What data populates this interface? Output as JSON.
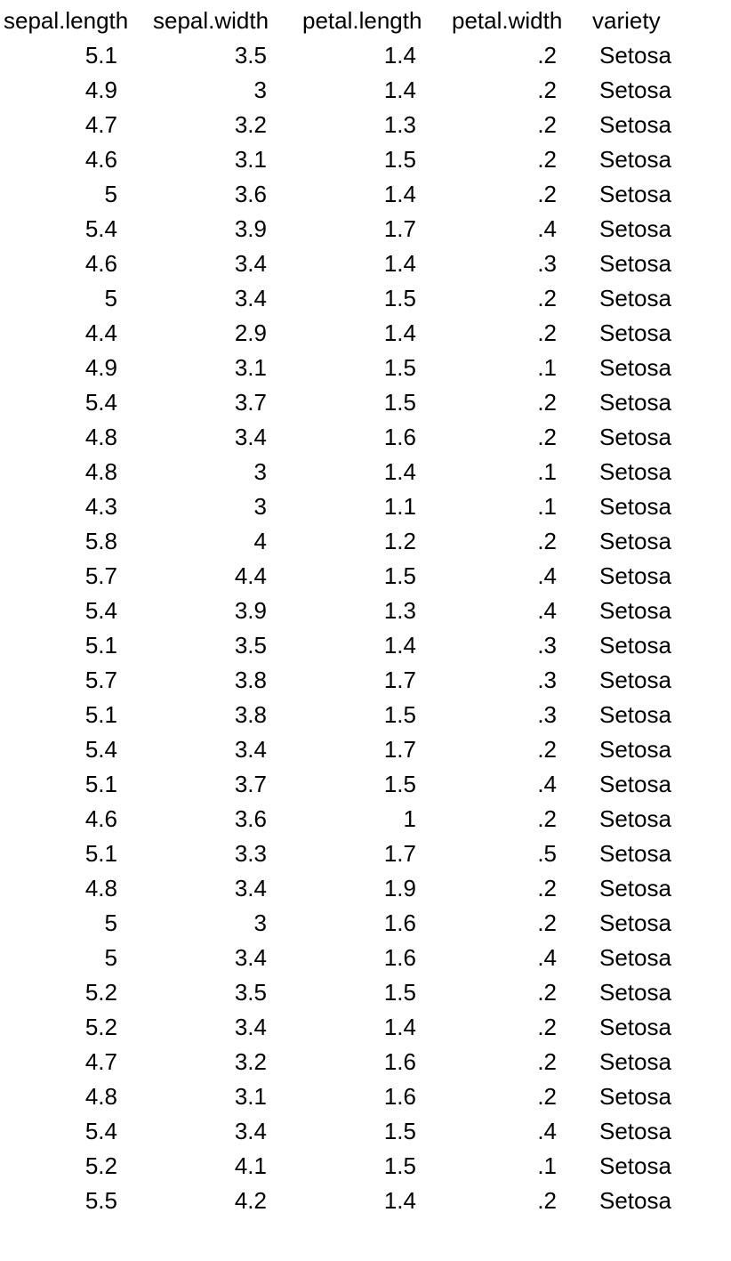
{
  "chart_data": {
    "type": "table",
    "title": "",
    "columns": [
      "sepal.length",
      "sepal.width",
      "petal.length",
      "petal.width",
      "variety"
    ],
    "rows": [
      {
        "sepal_length": "5.1",
        "sepal_width": "3.5",
        "petal_length": "1.4",
        "petal_width": ".2",
        "variety": "Setosa"
      },
      {
        "sepal_length": "4.9",
        "sepal_width": "3",
        "petal_length": "1.4",
        "petal_width": ".2",
        "variety": "Setosa"
      },
      {
        "sepal_length": "4.7",
        "sepal_width": "3.2",
        "petal_length": "1.3",
        "petal_width": ".2",
        "variety": "Setosa"
      },
      {
        "sepal_length": "4.6",
        "sepal_width": "3.1",
        "petal_length": "1.5",
        "petal_width": ".2",
        "variety": "Setosa"
      },
      {
        "sepal_length": "5",
        "sepal_width": "3.6",
        "petal_length": "1.4",
        "petal_width": ".2",
        "variety": "Setosa"
      },
      {
        "sepal_length": "5.4",
        "sepal_width": "3.9",
        "petal_length": "1.7",
        "petal_width": ".4",
        "variety": "Setosa"
      },
      {
        "sepal_length": "4.6",
        "sepal_width": "3.4",
        "petal_length": "1.4",
        "petal_width": ".3",
        "variety": "Setosa"
      },
      {
        "sepal_length": "5",
        "sepal_width": "3.4",
        "petal_length": "1.5",
        "petal_width": ".2",
        "variety": "Setosa"
      },
      {
        "sepal_length": "4.4",
        "sepal_width": "2.9",
        "petal_length": "1.4",
        "petal_width": ".2",
        "variety": "Setosa"
      },
      {
        "sepal_length": "4.9",
        "sepal_width": "3.1",
        "petal_length": "1.5",
        "petal_width": ".1",
        "variety": "Setosa"
      },
      {
        "sepal_length": "5.4",
        "sepal_width": "3.7",
        "petal_length": "1.5",
        "petal_width": ".2",
        "variety": "Setosa"
      },
      {
        "sepal_length": "4.8",
        "sepal_width": "3.4",
        "petal_length": "1.6",
        "petal_width": ".2",
        "variety": "Setosa"
      },
      {
        "sepal_length": "4.8",
        "sepal_width": "3",
        "petal_length": "1.4",
        "petal_width": ".1",
        "variety": "Setosa"
      },
      {
        "sepal_length": "4.3",
        "sepal_width": "3",
        "petal_length": "1.1",
        "petal_width": ".1",
        "variety": "Setosa"
      },
      {
        "sepal_length": "5.8",
        "sepal_width": "4",
        "petal_length": "1.2",
        "petal_width": ".2",
        "variety": "Setosa"
      },
      {
        "sepal_length": "5.7",
        "sepal_width": "4.4",
        "petal_length": "1.5",
        "petal_width": ".4",
        "variety": "Setosa"
      },
      {
        "sepal_length": "5.4",
        "sepal_width": "3.9",
        "petal_length": "1.3",
        "petal_width": ".4",
        "variety": "Setosa"
      },
      {
        "sepal_length": "5.1",
        "sepal_width": "3.5",
        "petal_length": "1.4",
        "petal_width": ".3",
        "variety": "Setosa"
      },
      {
        "sepal_length": "5.7",
        "sepal_width": "3.8",
        "petal_length": "1.7",
        "petal_width": ".3",
        "variety": "Setosa"
      },
      {
        "sepal_length": "5.1",
        "sepal_width": "3.8",
        "petal_length": "1.5",
        "petal_width": ".3",
        "variety": "Setosa"
      },
      {
        "sepal_length": "5.4",
        "sepal_width": "3.4",
        "petal_length": "1.7",
        "petal_width": ".2",
        "variety": "Setosa"
      },
      {
        "sepal_length": "5.1",
        "sepal_width": "3.7",
        "petal_length": "1.5",
        "petal_width": ".4",
        "variety": "Setosa"
      },
      {
        "sepal_length": "4.6",
        "sepal_width": "3.6",
        "petal_length": "1",
        "petal_width": ".2",
        "variety": "Setosa"
      },
      {
        "sepal_length": "5.1",
        "sepal_width": "3.3",
        "petal_length": "1.7",
        "petal_width": ".5",
        "variety": "Setosa"
      },
      {
        "sepal_length": "4.8",
        "sepal_width": "3.4",
        "petal_length": "1.9",
        "petal_width": ".2",
        "variety": "Setosa"
      },
      {
        "sepal_length": "5",
        "sepal_width": "3",
        "petal_length": "1.6",
        "petal_width": ".2",
        "variety": "Setosa"
      },
      {
        "sepal_length": "5",
        "sepal_width": "3.4",
        "petal_length": "1.6",
        "petal_width": ".4",
        "variety": "Setosa"
      },
      {
        "sepal_length": "5.2",
        "sepal_width": "3.5",
        "petal_length": "1.5",
        "petal_width": ".2",
        "variety": "Setosa"
      },
      {
        "sepal_length": "5.2",
        "sepal_width": "3.4",
        "petal_length": "1.4",
        "petal_width": ".2",
        "variety": "Setosa"
      },
      {
        "sepal_length": "4.7",
        "sepal_width": "3.2",
        "petal_length": "1.6",
        "petal_width": ".2",
        "variety": "Setosa"
      },
      {
        "sepal_length": "4.8",
        "sepal_width": "3.1",
        "petal_length": "1.6",
        "petal_width": ".2",
        "variety": "Setosa"
      },
      {
        "sepal_length": "5.4",
        "sepal_width": "3.4",
        "petal_length": "1.5",
        "petal_width": ".4",
        "variety": "Setosa"
      },
      {
        "sepal_length": "5.2",
        "sepal_width": "4.1",
        "petal_length": "1.5",
        "petal_width": ".1",
        "variety": "Setosa"
      },
      {
        "sepal_length": "5.5",
        "sepal_width": "4.2",
        "petal_length": "1.4",
        "petal_width": ".2",
        "variety": "Setosa"
      }
    ]
  }
}
